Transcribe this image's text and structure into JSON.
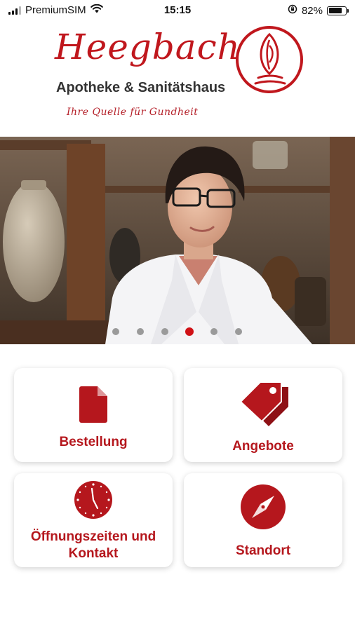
{
  "status_bar": {
    "carrier": "PremiumSIM",
    "time": "15:15",
    "battery_percent": "82%",
    "battery_level": 0.82
  },
  "brand": {
    "name": "Heegbach",
    "subtitle": "Apotheke & Sanitätshaus",
    "slogan": "Ihre Quelle für Gundheit"
  },
  "colors": {
    "accent": "#c0171d",
    "tile_icon": "#b5171d",
    "dot_active": "#d01116",
    "dot_inactive": "#9a9a9a"
  },
  "hero": {
    "slide_count": 6,
    "active_slide": 4
  },
  "tiles": [
    {
      "label": "Bestellung",
      "icon": "document-icon"
    },
    {
      "label": "Angebote",
      "icon": "tags-icon"
    },
    {
      "label": "Öffnungszeiten und Kontakt",
      "icon": "clock-icon"
    },
    {
      "label": "Standort",
      "icon": "compass-icon"
    }
  ]
}
